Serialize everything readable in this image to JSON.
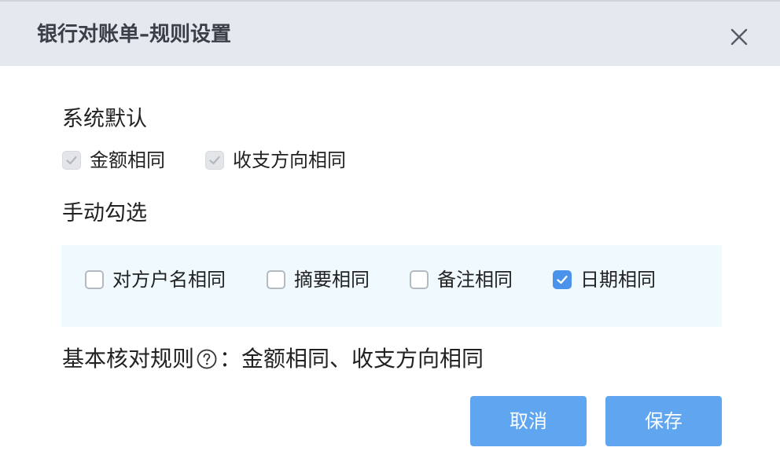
{
  "dialog": {
    "title": "银行对账单–规则设置"
  },
  "system_default": {
    "heading": "系统默认",
    "options": [
      {
        "label": "金额相同",
        "checked": true,
        "disabled": true
      },
      {
        "label": "收支方向相同",
        "checked": true,
        "disabled": true
      }
    ]
  },
  "manual": {
    "heading": "手动勾选",
    "options": [
      {
        "label": "对方户名相同",
        "checked": false
      },
      {
        "label": "摘要相同",
        "checked": false
      },
      {
        "label": "备注相同",
        "checked": false
      },
      {
        "label": "日期相同",
        "checked": true
      }
    ]
  },
  "rule": {
    "label": "基本核对规则",
    "separator": "：",
    "value": "金额相同、收支方向相同"
  },
  "buttons": {
    "cancel": "取消",
    "save": "保存"
  },
  "colors": {
    "header_bg": "#e5e8ef",
    "panel_bg": "#f0fafe",
    "checked": "#4b92ea",
    "button": "#5fa5ef"
  }
}
